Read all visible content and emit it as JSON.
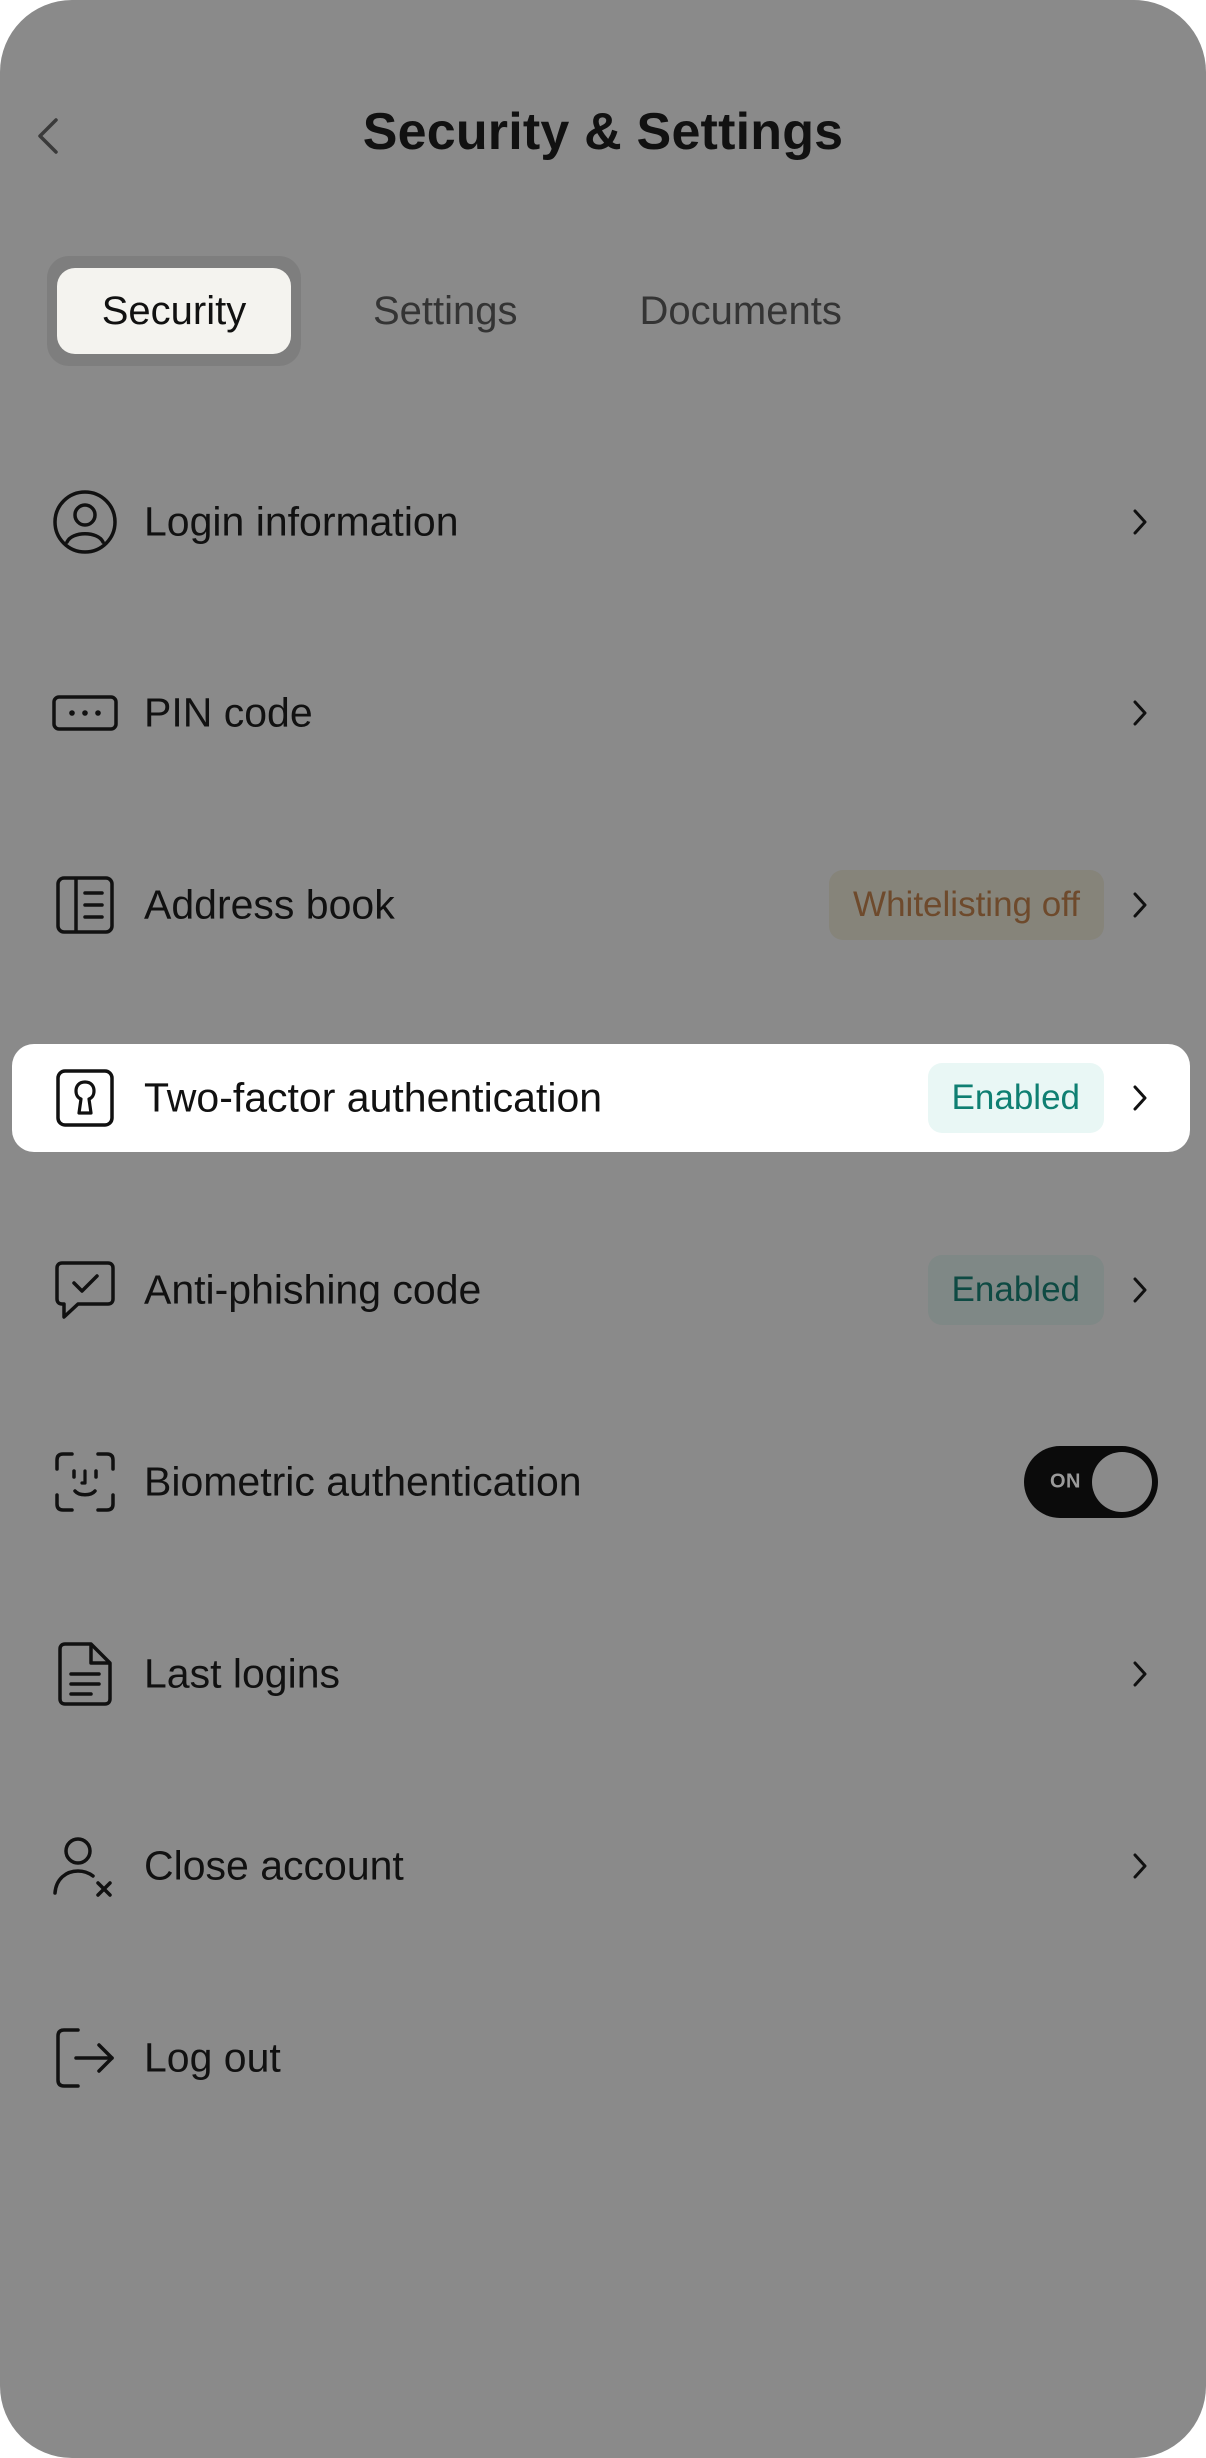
{
  "header": {
    "title": "Security & Settings",
    "back_icon": "chevron-left-icon"
  },
  "tabs": [
    {
      "label": "Security",
      "active": true
    },
    {
      "label": "Settings",
      "active": false
    },
    {
      "label": "Documents",
      "active": false
    }
  ],
  "menu": {
    "items": [
      {
        "label": "Login information",
        "icon": "user-circle-icon"
      },
      {
        "label": "PIN code",
        "icon": "pin-dots-icon"
      },
      {
        "label": "Address book",
        "icon": "address-book-icon",
        "badge": "Whitelisting off"
      },
      {
        "label": "Two-factor authentication",
        "icon": "keyhole-lock-icon",
        "badge": "Enabled",
        "highlighted": true
      },
      {
        "label": "Anti-phishing code",
        "icon": "chat-check-icon",
        "badge": "Enabled"
      },
      {
        "label": "Biometric authentication",
        "icon": "face-id-icon",
        "toggle": "ON"
      },
      {
        "label": "Last logins",
        "icon": "document-lines-icon"
      },
      {
        "label": "Close account",
        "icon": "user-remove-icon"
      },
      {
        "label": "Log out",
        "icon": "logout-icon"
      }
    ]
  },
  "colors": {
    "overlay": "#8a8a8a",
    "highlight": "#ffffff",
    "enabled_text": "#0f7f72",
    "enabled_bg": "#e9f7f5",
    "warning_text": "#6e4a2c",
    "toggle_bg": "#0b0b0b"
  }
}
